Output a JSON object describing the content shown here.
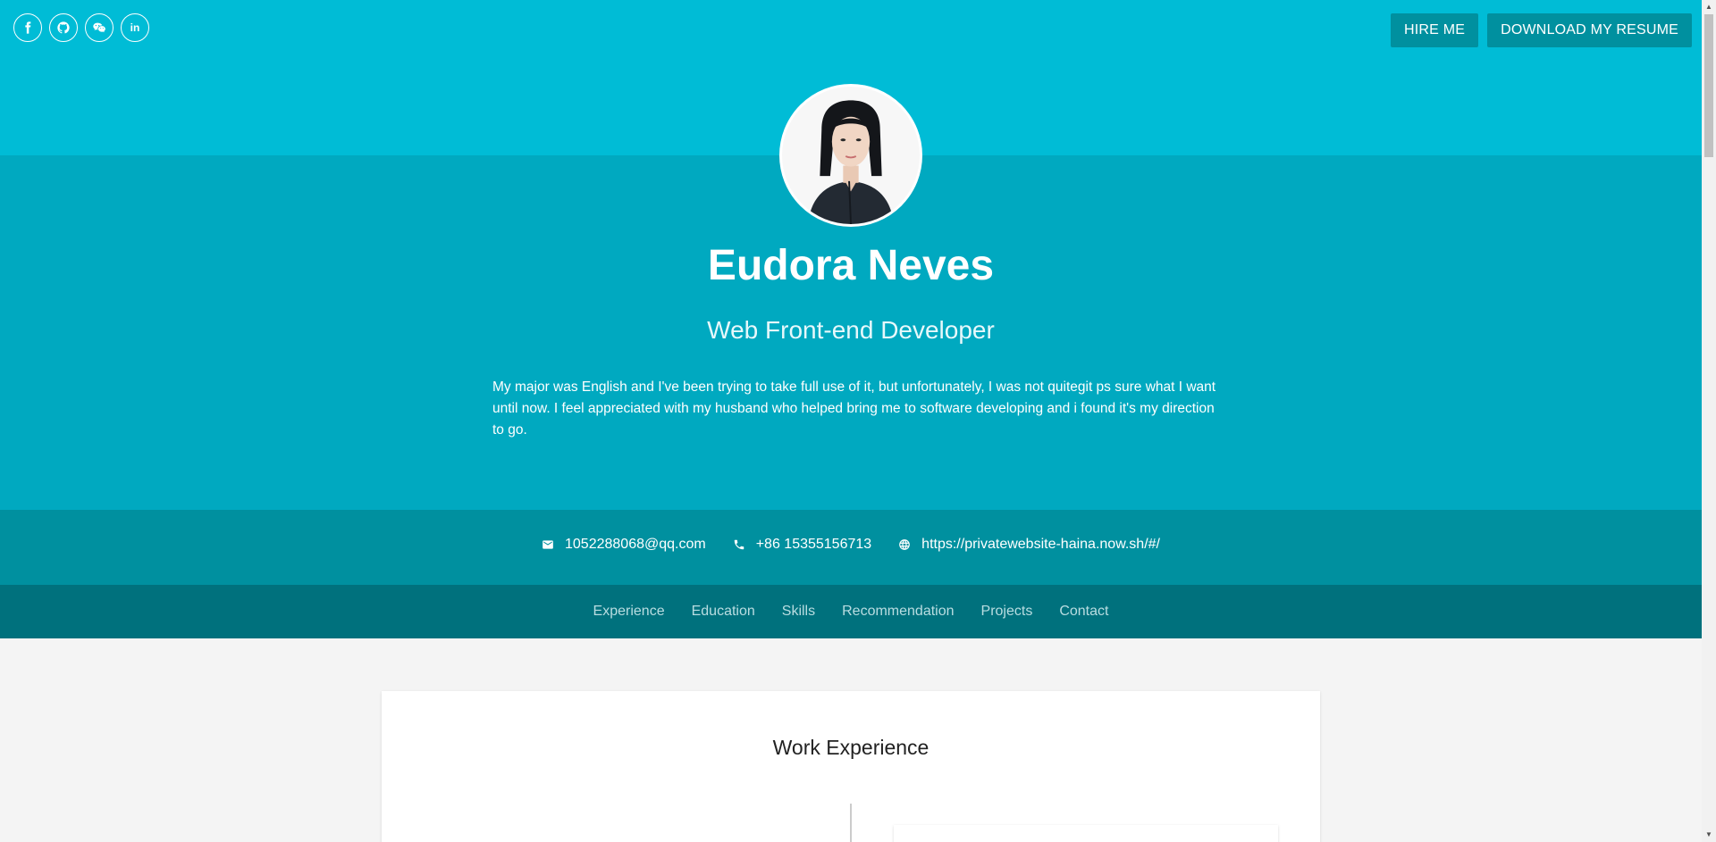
{
  "social_links": [
    {
      "name": "facebook",
      "icon": "facebook-icon"
    },
    {
      "name": "github",
      "icon": "github-icon"
    },
    {
      "name": "wechat",
      "icon": "wechat-icon"
    },
    {
      "name": "linkedin",
      "icon": "linkedin-icon"
    }
  ],
  "header": {
    "hire_label": "HIRE ME",
    "resume_label": "DOWNLOAD MY RESUME"
  },
  "profile": {
    "name": "Eudora Neves",
    "role": "Web Front-end Developer",
    "bio": "My major was English and I've been trying to take full use of it, but unfortunately, I was not quitegit ps sure what I want until now. I feel appreciated with my husband who helped bring me to software developing and i found it's my direction to go."
  },
  "contacts": {
    "email": "1052288068@qq.com",
    "phone": "+86 15355156713",
    "website": "https://privatewebsite-haina.now.sh/#/"
  },
  "nav": {
    "items": [
      "Experience",
      "Education",
      "Skills",
      "Recommendation",
      "Projects",
      "Contact"
    ]
  },
  "main": {
    "section_title": "Work Experience"
  },
  "colors": {
    "top_band": "#00bcd6",
    "hero": "#00a9c0",
    "contact_bar": "#00909f",
    "nav_bar": "#00717d"
  }
}
